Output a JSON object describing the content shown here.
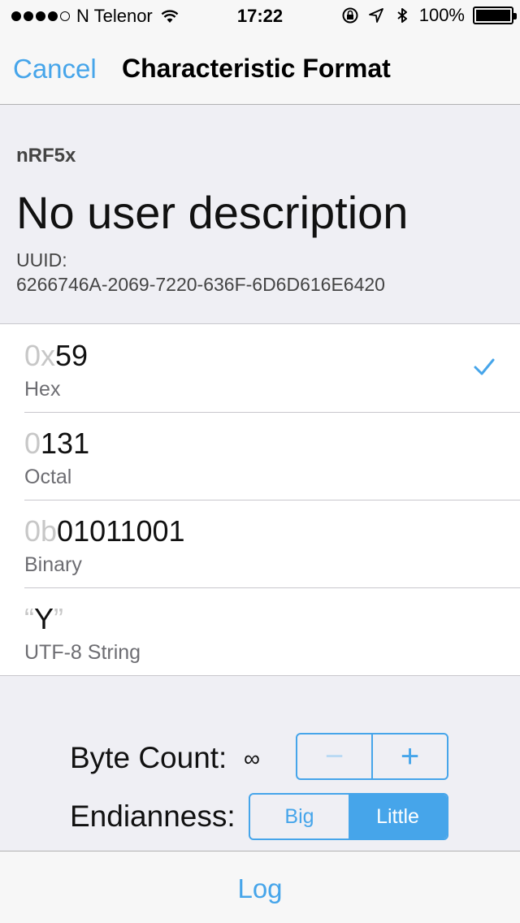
{
  "status_bar": {
    "carrier": "N Telenor",
    "time": "17:22",
    "battery": "100%"
  },
  "nav": {
    "cancel_label": "Cancel",
    "title": "Characteristic Format"
  },
  "header": {
    "device_name": "nRF5x",
    "description": "No user description",
    "uuid_label": "UUID:",
    "uuid_value": "6266746A-2069-7220-636F-6D6D616E6420"
  },
  "formats": [
    {
      "prefix": "0x",
      "value": "59",
      "label": "Hex",
      "selected": true
    },
    {
      "prefix": "0",
      "value": "131",
      "label": "Octal",
      "selected": false
    },
    {
      "prefix": "0b",
      "value": "01011001",
      "label": "Binary",
      "selected": false
    },
    {
      "prefix": "“",
      "value": "Y",
      "suffix": "”",
      "label": "UTF-8 String",
      "selected": false
    }
  ],
  "controls": {
    "byte_count_label": "Byte Count:",
    "byte_count_value": "∞",
    "stepper_minus": "−",
    "stepper_plus": "+",
    "endianness_label": "Endianness:",
    "endianness_options": [
      "Big",
      "Little"
    ],
    "endianness_selected": "Little"
  },
  "toolbar": {
    "log_label": "Log"
  },
  "colors": {
    "accent": "#46a5ea",
    "background": "#efeff4"
  }
}
